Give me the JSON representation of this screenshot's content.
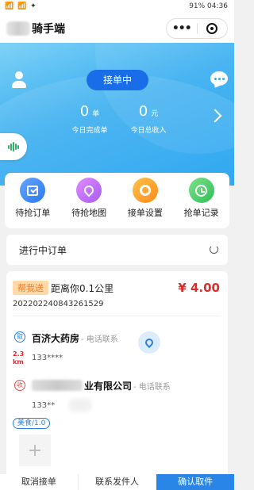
{
  "statusbar": {
    "left": "📶 📶 ✦",
    "right": "91% 04:36"
  },
  "header": {
    "title": "骑手端",
    "more_icon": "more-dots-icon",
    "close_icon": "target-icon"
  },
  "hero": {
    "status_button": "接单中",
    "today_orders": "0",
    "today_orders_unit": "单",
    "today_orders_label": "今日完成单",
    "today_income": "0",
    "today_income_unit": "元",
    "today_income_label": "今日总收入"
  },
  "menu": [
    {
      "label": "待抢订单"
    },
    {
      "label": "待抢地图"
    },
    {
      "label": "接单设置"
    },
    {
      "label": "抢单记录"
    }
  ],
  "section": {
    "title": "进行中订单"
  },
  "order": {
    "tag": "帮我送",
    "distance": "距离你0.1公里",
    "price": "¥ 4.00",
    "order_no": "20220224084326​1529",
    "pick_badge": "取",
    "pick_name": "百济大药房",
    "pick_contact": "- 电话联系",
    "pick_phone": "133****",
    "km_value": "2.3",
    "km_unit": "km",
    "drop_badge": "收",
    "drop_name": "业有限公司",
    "drop_contact": "- 电话联系",
    "drop_phone": "133**",
    "drop_phone_tail": "3",
    "goods_tag": "美食/1.0",
    "add_symbol": "+"
  },
  "actions": {
    "cancel": "取消接单",
    "contact": "联系发件人",
    "confirm": "确认取件"
  },
  "colors": {
    "accent": "#2a86e6",
    "price": "#e12a2a"
  }
}
